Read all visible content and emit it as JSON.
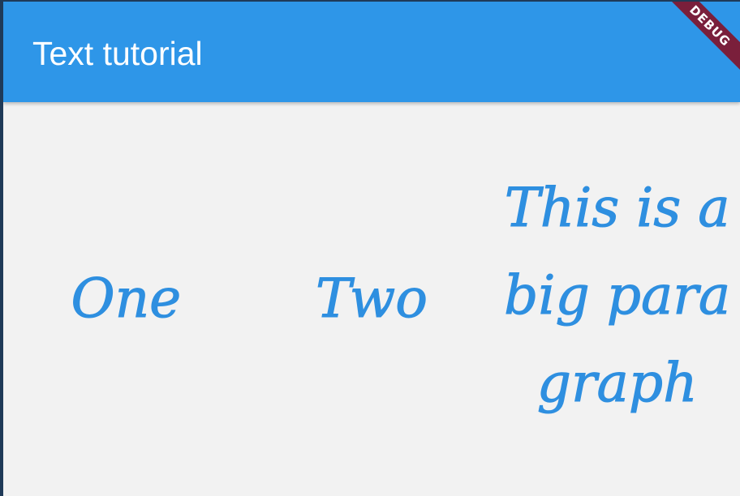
{
  "app_bar": {
    "title": "Text tutorial",
    "debug_banner": "DEBUG",
    "color": "#2e96e8"
  },
  "row": {
    "items": [
      "One",
      "Two",
      "This is a big paragraph"
    ]
  },
  "colors": {
    "text_accent": "#2e8fe0",
    "background": "#f2f2f2",
    "banner": "#7a1f3b"
  }
}
